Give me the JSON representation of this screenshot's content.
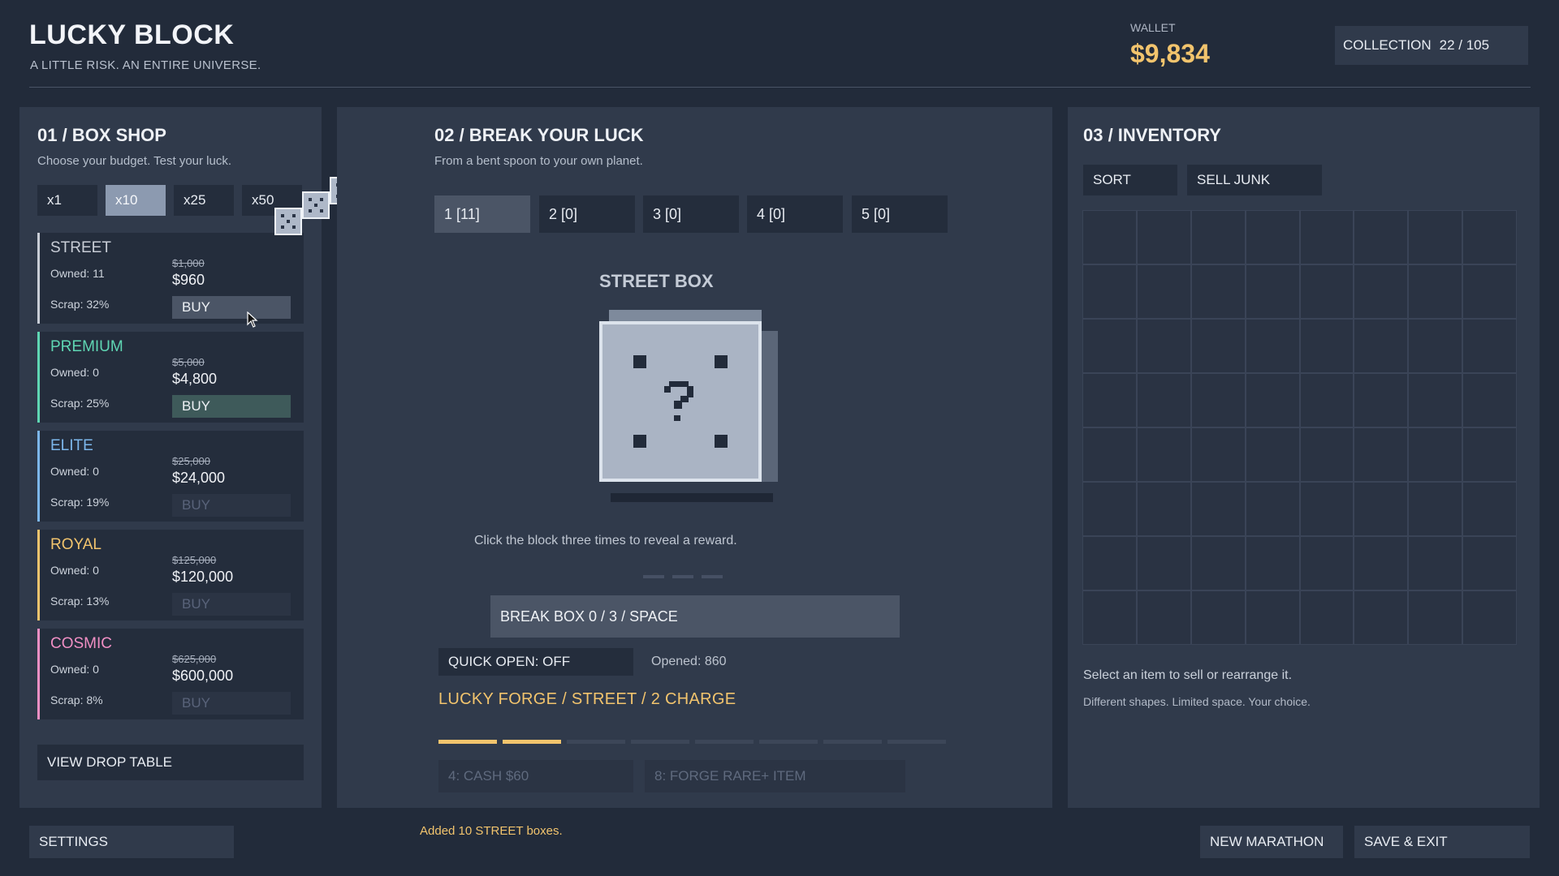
{
  "header": {
    "title": "LUCKY BLOCK",
    "subtitle": "A LITTLE RISK. AN ENTIRE UNIVERSE.",
    "wallet_label": "WALLET",
    "wallet_value": "$9,834",
    "collection_label": "COLLECTION",
    "collection_value": "22 / 105"
  },
  "shop": {
    "title": "01 / BOX SHOP",
    "desc": "Choose your budget. Test your luck.",
    "quantities": [
      "x1",
      "x10",
      "x25",
      "x50"
    ],
    "selected_quantity": "x10",
    "drag_count": "x10",
    "boxes": [
      {
        "name": "STREET",
        "owned": "Owned: 11",
        "scrap": "Scrap: 32%",
        "old_price": "$1,000",
        "price": "$960",
        "buy": "BUY",
        "color": "#c8cdd6"
      },
      {
        "name": "PREMIUM",
        "owned": "Owned: 0",
        "scrap": "Scrap: 25%",
        "old_price": "$5,000",
        "price": "$4,800",
        "buy": "BUY",
        "color": "#5fd6b3"
      },
      {
        "name": "ELITE",
        "owned": "Owned: 0",
        "scrap": "Scrap: 19%",
        "old_price": "$25,000",
        "price": "$24,000",
        "buy": "BUY",
        "color": "#7db7ec"
      },
      {
        "name": "ROYAL",
        "owned": "Owned: 0",
        "scrap": "Scrap: 13%",
        "old_price": "$125,000",
        "price": "$120,000",
        "buy": "BUY",
        "color": "#f2c46d"
      },
      {
        "name": "COSMIC",
        "owned": "Owned: 0",
        "scrap": "Scrap: 8%",
        "old_price": "$625,000",
        "price": "$600,000",
        "buy": "BUY",
        "color": "#f08fc4"
      }
    ],
    "view_drop": "VIEW DROP TABLE"
  },
  "breaker": {
    "title": "02 / BREAK YOUR LUCK",
    "desc": "From a bent spoon to your own planet.",
    "slots": [
      "1  [11]",
      "2  [0]",
      "3  [0]",
      "4  [0]",
      "5  [0]"
    ],
    "box_name": "STREET BOX",
    "hint": "Click the block three times to reveal a reward.",
    "break_button": "BREAK BOX  0 / 3  /  SPACE",
    "quick_open": "QUICK OPEN: OFF",
    "opened": "Opened: 860",
    "forge": "LUCKY FORGE / STREET / 2 CHARGE",
    "forge_charge": 2,
    "forge_total": 8,
    "rewards": [
      "4: CASH $60",
      "8: FORGE RARE+ ITEM"
    ]
  },
  "inventory": {
    "title": "03 / INVENTORY",
    "sort": "SORT",
    "sell_junk": "SELL JUNK",
    "message": "Select an item to sell or rearrange it.",
    "sub": "Different shapes. Limited space. Your choice."
  },
  "footer": {
    "settings": "SETTINGS",
    "status": "Added 10 STREET boxes.",
    "new_marathon": "NEW MARATHON",
    "save_exit": "SAVE & EXIT"
  },
  "icons": {
    "box": "question-block-icon",
    "die": "die-icon",
    "cursor": "mouse-cursor-icon"
  }
}
